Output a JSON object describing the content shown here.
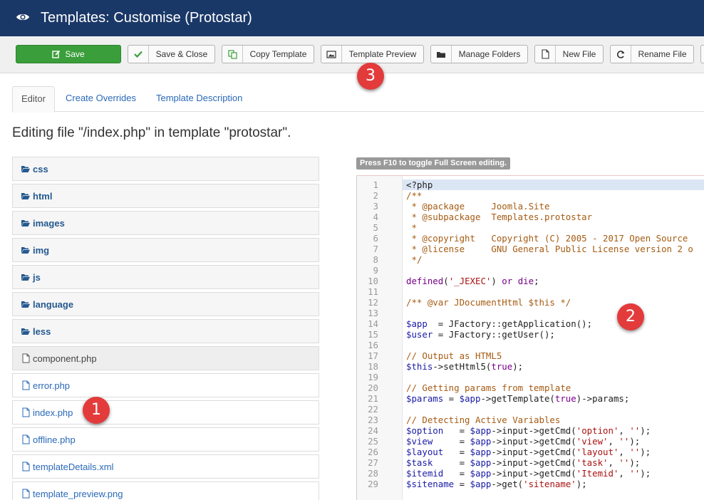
{
  "header": {
    "icon": "eye-icon",
    "title": "Templates: Customise (Protostar)"
  },
  "toolbar": {
    "buttons": [
      {
        "label": "Save",
        "icon": "edit-icon"
      },
      {
        "label": "Save & Close",
        "icon": "checkmark-icon"
      },
      {
        "label": "Copy Template",
        "icon": "copy-icon"
      },
      {
        "label": "Template Preview",
        "icon": "image-icon"
      },
      {
        "label": "Manage Folders",
        "icon": "folder-icon"
      },
      {
        "label": "New File",
        "icon": "file-icon"
      },
      {
        "label": "Rename File",
        "icon": "refresh-icon"
      }
    ]
  },
  "tabs": [
    {
      "label": "Editor",
      "active": true
    },
    {
      "label": "Create Overrides",
      "active": false
    },
    {
      "label": "Template Description",
      "active": false
    }
  ],
  "heading": "Editing file \"/index.php\" in template \"protostar\".",
  "file_tree": {
    "folders": [
      "css",
      "html",
      "images",
      "img",
      "js",
      "language",
      "less"
    ],
    "files": [
      "component.php",
      "error.php",
      "index.php",
      "offline.php",
      "templateDetails.xml",
      "template_preview.png"
    ],
    "selected": "component.php"
  },
  "editor": {
    "hint": "Press F10 to toggle Full Screen editing.",
    "highlighted_line": 1,
    "lines": [
      "<?php",
      "/**",
      " * @package     Joomla.Site",
      " * @subpackage  Templates.protostar",
      " *",
      " * @copyright   Copyright (C) 2005 - 2017 Open Source",
      " * @license     GNU General Public License version 2 o",
      " */",
      "",
      "defined('_JEXEC') or die;",
      "",
      "/** @var JDocumentHtml $this */",
      "",
      "$app  = JFactory::getApplication();",
      "$user = JFactory::getUser();",
      "",
      "// Output as HTML5",
      "$this->setHtml5(true);",
      "",
      "// Getting params from template",
      "$params = $app->getTemplate(true)->params;",
      "",
      "// Detecting Active Variables",
      "$option   = $app->input->getCmd('option', '');",
      "$view     = $app->input->getCmd('view', '');",
      "$layout   = $app->input->getCmd('layout', '');",
      "$task     = $app->input->getCmd('task', '');",
      "$itemid   = $app->input->getCmd('Itemid', '');",
      "$sitename = $app->get('sitename');"
    ]
  },
  "annotations": [
    "1",
    "2",
    "3"
  ],
  "colors": {
    "header_bg": "#1a3867",
    "save_button": "#3a9e3a",
    "link": "#2a69b8",
    "badge": "#e33b3b"
  }
}
